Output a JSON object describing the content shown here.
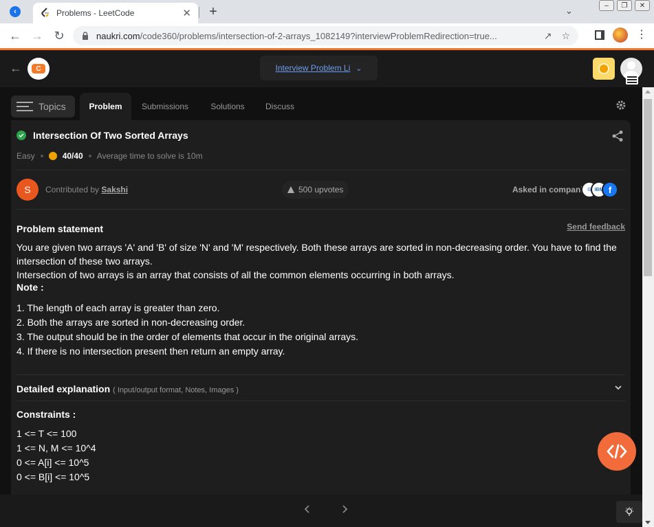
{
  "browser": {
    "tab_title": "Problems - LeetCode",
    "url_domain": "naukri.com",
    "url_path": "/code360/problems/intersection-of-2-arrays_1082149?interviewProblemRedirection=true..."
  },
  "header": {
    "interview_problem_label": "Interview Problem Li"
  },
  "tabs": {
    "topics": "Topics",
    "items": [
      "Problem",
      "Submissions",
      "Solutions",
      "Discuss"
    ]
  },
  "problem": {
    "title": "Intersection Of Two Sorted Arrays",
    "difficulty": "Easy",
    "score": "40/40",
    "avg_time": "Average time to solve is 10m",
    "contributor_prefix": "Contributed by",
    "contributor_name": "Sakshi",
    "contributor_initial": "S",
    "upvotes": "500 upvotes",
    "asked_label": "Asked in companies",
    "statement_heading": "Problem statement",
    "feedback_label": "Send feedback",
    "statement_1": "You are given two arrays 'A' and 'B' of size 'N' and 'M' respectively. Both these arrays are sorted in non-decreasing order. You have to find the intersection of these two arrays.",
    "statement_2": "Intersection of two arrays is an array that consists of all the common elements occurring in both arrays.",
    "note_heading": "Note :",
    "notes": [
      "1. The length of each array is greater than zero.",
      "2. Both the arrays are sorted in non-decreasing order.",
      "3. The output should be in the order of elements that occur in the original arrays.",
      "4. If there is no intersection present then return an empty array."
    ],
    "detailed_heading": "Detailed explanation",
    "detailed_sub": "( Input/output format, Notes, Images )",
    "constraints_heading": "Constraints :",
    "constraints": [
      "1 <= T <= 100",
      "1 <= N, M <= 10^4",
      "0 <= A[i] <= 10^5",
      "0 <= B[i] <= 10^5"
    ]
  },
  "colors": {
    "accent": "#f47b2a",
    "fab": "#f26b3a",
    "solved": "#2ea44f"
  }
}
